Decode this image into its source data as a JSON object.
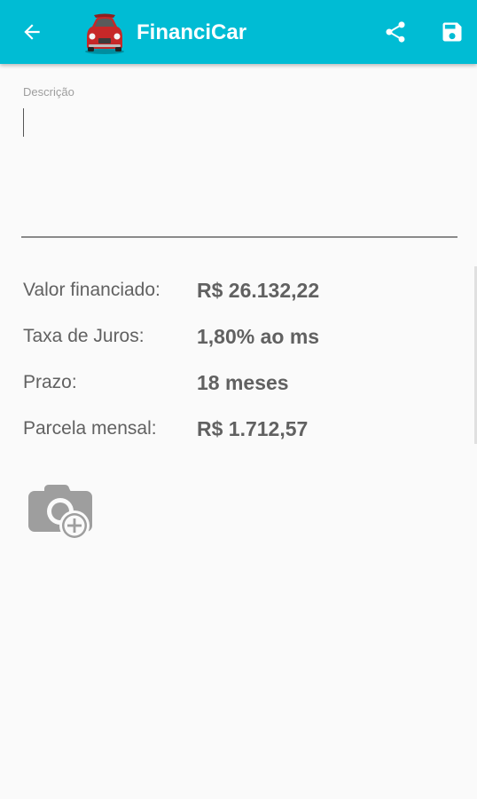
{
  "appbar": {
    "title": "FinanciCar",
    "back_icon": "arrow-left-icon",
    "logo_icon": "red-car-icon",
    "share_icon": "share-icon",
    "save_icon": "floppy-disk-icon",
    "background_color": "#00bcd4"
  },
  "description": {
    "label": "Descrição",
    "value": ""
  },
  "summary": [
    {
      "label": "Valor financiado:",
      "value": "R$ 26.132,22"
    },
    {
      "label": "Taxa de Juros:",
      "value": "1,80% ao ms"
    },
    {
      "label": "Prazo:",
      "value": "18 meses"
    },
    {
      "label": "Parcela mensal:",
      "value": "R$ 1.712,57"
    }
  ],
  "photo": {
    "icon": "add-photo-camera-icon"
  }
}
